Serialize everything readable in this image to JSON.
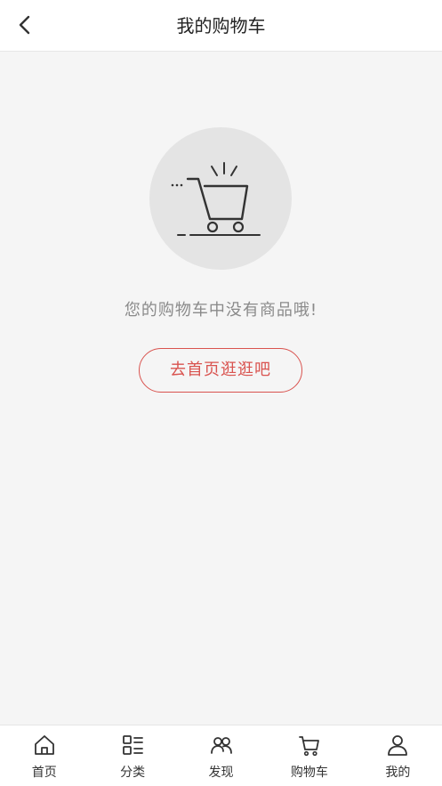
{
  "header": {
    "title": "我的购物车",
    "back_icon": "chevron-left-icon"
  },
  "main": {
    "illustration_icon": "empty-cart-icon",
    "empty_message": "您的购物车中没有商品哦!",
    "go_home_label": "去首页逛逛吧"
  },
  "tabbar": {
    "items": [
      {
        "label": "首页",
        "icon": "home-icon"
      },
      {
        "label": "分类",
        "icon": "category-icon"
      },
      {
        "label": "发现",
        "icon": "discover-icon"
      },
      {
        "label": "购物车",
        "icon": "cart-icon"
      },
      {
        "label": "我的",
        "icon": "profile-icon"
      }
    ]
  },
  "colors": {
    "accent": "#d9534f",
    "background": "#f5f5f5",
    "muted_text": "#8a8a8a"
  }
}
